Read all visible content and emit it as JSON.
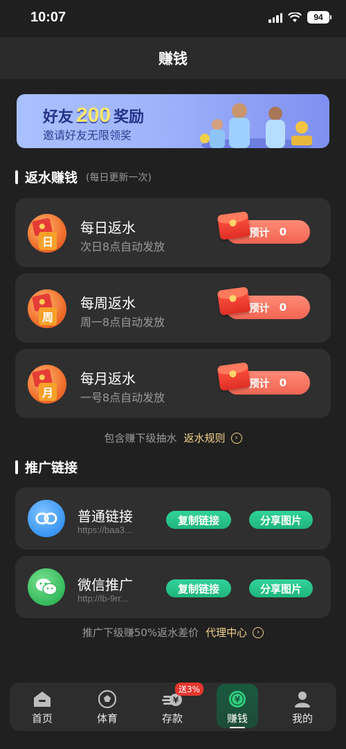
{
  "status_bar": {
    "time": "10:07",
    "battery": "94"
  },
  "header": {
    "title": "赚钱"
  },
  "banner": {
    "line1_pre": "好友",
    "line1_num": "200",
    "line1_post": "奖励",
    "line2": "邀请好友无限领奖"
  },
  "rebate_section": {
    "title": "返水赚钱",
    "subtitle": "(每日更新一次)"
  },
  "rebates": [
    {
      "icon_char": "日",
      "title": "每日返水",
      "desc": "次日8点自动发放",
      "est_label": "预计",
      "est_value": "0"
    },
    {
      "icon_char": "周",
      "title": "每周返水",
      "desc": "周一8点自动发放",
      "est_label": "预计",
      "est_value": "0"
    },
    {
      "icon_char": "月",
      "title": "每月返水",
      "desc": "一号8点自动发放",
      "est_label": "预计",
      "est_value": "0"
    }
  ],
  "rebate_note": {
    "text": "包含赚下级抽水",
    "link": "返水规则"
  },
  "promo_section": {
    "title": "推广链接"
  },
  "links": [
    {
      "icon": "link-icon",
      "title": "普通链接",
      "url": "https://baa3...",
      "copy": "复制链接",
      "share": "分享图片"
    },
    {
      "icon": "wechat-icon",
      "title": "微信推广",
      "url": "http://lb-9rr...",
      "copy": "复制链接",
      "share": "分享图片"
    }
  ],
  "promo_note": {
    "text": "推广下级赚50%返水差价",
    "link": "代理中心"
  },
  "tabbar": {
    "items": [
      {
        "label": "首页",
        "icon": "home-icon"
      },
      {
        "label": "体育",
        "icon": "soccer-ball-icon"
      },
      {
        "label": "存款",
        "icon": "deposit-icon",
        "badge": "送3%"
      },
      {
        "label": "赚钱",
        "icon": "earn-money-icon"
      },
      {
        "label": "我的",
        "icon": "user-icon"
      }
    ]
  },
  "colors": {
    "accent_green": "#1fb57d",
    "gold_link": "#f3d38a",
    "red_button": "#f26552"
  }
}
